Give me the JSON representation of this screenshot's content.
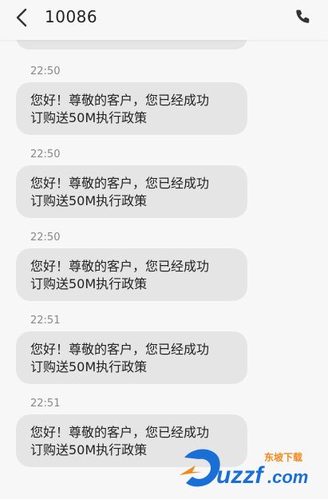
{
  "header": {
    "title": "10086",
    "back_icon": "chevron-left-icon",
    "call_icon": "phone-icon"
  },
  "messages": [
    {
      "time": "22:50",
      "line1": "您好！尊敬的客户，您已经成功",
      "line2": "订购送50M执行政策"
    },
    {
      "time": "22:50",
      "line1": "您好！尊敬的客户，您已经成功",
      "line2": "订购送50M执行政策"
    },
    {
      "time": "22:50",
      "line1": "您好！尊敬的客户，您已经成功",
      "line2": "订购送50M执行政策"
    },
    {
      "time": "22:51",
      "line1": "您好！尊敬的客户，您已经成功",
      "line2": "订购送50M执行政策"
    },
    {
      "time": "22:51",
      "line1": "您好！尊敬的客户，您已经成功",
      "line2": "订购送50M执行政策"
    }
  ],
  "watermark": {
    "text": "东坡下载 uzzf.com"
  },
  "colors": {
    "background": "#f7f7f7",
    "bubble": "#e5e5e5",
    "time": "#888888",
    "text": "#222222",
    "watermark_blue": "#1a6fd6",
    "watermark_orange": "#f08a1c"
  }
}
